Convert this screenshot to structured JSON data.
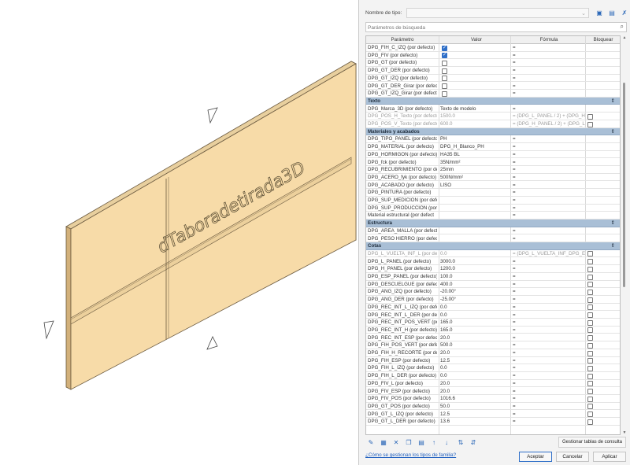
{
  "viewport": {
    "panel_text": "dTaboradetirada3D"
  },
  "dialog": {
    "type_name_label": "Nombre de tipo:",
    "type_name_value": "",
    "search_placeholder": "Parámetros de búsqueda",
    "columns": {
      "param": "Parámetro",
      "value": "Valor",
      "formula": "Fórmula",
      "lock": "Bloquear"
    },
    "rows": [
      {
        "kind": "param",
        "name": "DPG_FIH_C_IZQ (por defecto)",
        "check": true,
        "formula": "="
      },
      {
        "kind": "param",
        "name": "DPG_FIV (por defecto)",
        "check": true,
        "formula": "="
      },
      {
        "kind": "param",
        "name": "DPG_GT (por defecto)",
        "check": false,
        "formula": "="
      },
      {
        "kind": "param",
        "name": "DPG_GT_DER (por defecto)",
        "check": false,
        "formula": "="
      },
      {
        "kind": "param",
        "name": "DPG_GT_IZQ (por defecto)",
        "check": false,
        "formula": "="
      },
      {
        "kind": "param",
        "name": "DPG_GT_DER_Girar (por defect",
        "check": false,
        "formula": "="
      },
      {
        "kind": "param",
        "name": "DPG_GT_IZQ_Girar (por defect",
        "check": false,
        "formula": "="
      },
      {
        "kind": "group",
        "name": "Texto"
      },
      {
        "kind": "param",
        "name": "DPG_Marca_3D (por defecto)",
        "value": "Texto de modelo",
        "formula": "="
      },
      {
        "kind": "param",
        "muted": true,
        "name": "DPG_POS_H_Texto (por defecto",
        "value": "1500.0",
        "formula": "= (DPG_L_PANEL / 2) + (DPG_H_",
        "lock": false
      },
      {
        "kind": "param",
        "muted": true,
        "name": "DPG_POS_V_Texto (por defecto",
        "value": "600.0",
        "formula": "= (DPG_H_PANEL / 2) + (DPG_L_",
        "lock": false
      },
      {
        "kind": "group",
        "name": "Materiales y acabados"
      },
      {
        "kind": "param",
        "name": "DPG_TIPO_PANEL (por defecto)",
        "value": "PH",
        "formula": "="
      },
      {
        "kind": "param",
        "name": "DPG_MATERIAL (por defecto)",
        "value": "DPG_H_Blanco_PH",
        "formula": "="
      },
      {
        "kind": "param",
        "name": "DPG_HORMIGON (por defecto)",
        "value": "HA35 BL",
        "formula": "="
      },
      {
        "kind": "param",
        "name": "DPG_fck (por defecto)",
        "value": "35N/mm²",
        "formula": "="
      },
      {
        "kind": "param",
        "name": "DPG_RECUBRIMIENTO (por def",
        "value": "25mm",
        "formula": "="
      },
      {
        "kind": "param",
        "name": "DPG_ACERO_fyk (por defecto)",
        "value": "500N/mm²",
        "formula": "="
      },
      {
        "kind": "param",
        "name": "DPG_ACABADO (por defecto)",
        "value": "LISO",
        "formula": "="
      },
      {
        "kind": "param",
        "name": "DPG_PINTURA (por defecto)",
        "value": "",
        "formula": "="
      },
      {
        "kind": "param",
        "name": "DPG_SUP_MEDICION (por defe",
        "value": "",
        "formula": "="
      },
      {
        "kind": "param",
        "name": "DPG_SUP_PRODUCCION (por",
        "value": "",
        "formula": "="
      },
      {
        "kind": "param",
        "name": "Material estructural (por defect",
        "value": "",
        "formula": "="
      },
      {
        "kind": "group",
        "name": "Estructura"
      },
      {
        "kind": "param",
        "name": "DPG_AREA_MALLA (por defect",
        "value": "",
        "formula": "="
      },
      {
        "kind": "param",
        "name": "DPG_PESO HIERRO (por defect",
        "value": "",
        "formula": "="
      },
      {
        "kind": "group",
        "name": "Cotas"
      },
      {
        "kind": "param",
        "muted": true,
        "name": "DPG_L_VUELTA_INF_L (por defe",
        "value": "0.0",
        "formula": "= (DPG_L_VUELTA_INF_DPG_ES",
        "lock": false
      },
      {
        "kind": "param",
        "name": "DPG_L_PANEL (por defecto)",
        "value": "3000.0",
        "formula": "=",
        "lock": false
      },
      {
        "kind": "param",
        "name": "DPG_H_PANEL (por defecto)",
        "value": "1200.0",
        "formula": "=",
        "lock": false
      },
      {
        "kind": "param",
        "name": "DPG_ESP_PANEL (por defecto)",
        "value": "100.0",
        "formula": "=",
        "lock": false
      },
      {
        "kind": "param",
        "name": "DPG_DESCUELGUE (por defecto",
        "value": "400.0",
        "formula": "=",
        "lock": false
      },
      {
        "kind": "param",
        "name": "DPG_ANG_IZQ (por defecto)",
        "value": "-20.00°",
        "formula": "=",
        "lock": false
      },
      {
        "kind": "param",
        "name": "DPG_ANG_DER (por defecto)",
        "value": "-25.00°",
        "formula": "=",
        "lock": false
      },
      {
        "kind": "param",
        "name": "DPG_REC_INT_L_IZQ (por defec",
        "value": "0.0",
        "formula": "=",
        "lock": false
      },
      {
        "kind": "param",
        "name": "DPG_REC_INT_L_DER (por defe",
        "value": "0.0",
        "formula": "=",
        "lock": false
      },
      {
        "kind": "param",
        "name": "DPG_REC_INT_POS_VERT (por",
        "value": "165.0",
        "formula": "=",
        "lock": false
      },
      {
        "kind": "param",
        "name": "DPG_REC_INT_H (por defecto)",
        "value": "165.0",
        "formula": "=",
        "lock": false
      },
      {
        "kind": "param",
        "name": "DPG_REC_INT_ESP (por defecto",
        "value": "20.0",
        "formula": "=",
        "lock": false
      },
      {
        "kind": "param",
        "name": "DPG_FIH_POS_VERT (por defec",
        "value": "500.0",
        "formula": "=",
        "lock": false
      },
      {
        "kind": "param",
        "name": "DPG_FIH_H_RECORTE (por def",
        "value": "20.0",
        "formula": "=",
        "lock": false
      },
      {
        "kind": "param",
        "name": "DPG_FIH_ESP (por defecto)",
        "value": "12.5",
        "formula": "=",
        "lock": false
      },
      {
        "kind": "param",
        "name": "DPG_FIH_L_IZQ (por defecto)",
        "value": "0.0",
        "formula": "=",
        "lock": false
      },
      {
        "kind": "param",
        "name": "DPG_FIH_L_DER (por defecto)",
        "value": "0.0",
        "formula": "=",
        "lock": false
      },
      {
        "kind": "param",
        "name": "DPG_FIV_L (por defecto)",
        "value": "20.0",
        "formula": "=",
        "lock": false
      },
      {
        "kind": "param",
        "name": "DPG_FIV_ESP (por defecto)",
        "value": "20.0",
        "formula": "=",
        "lock": false
      },
      {
        "kind": "param",
        "name": "DPG_FIV_POS (por defecto)",
        "value": "1016.6",
        "formula": "=",
        "lock": false
      },
      {
        "kind": "param",
        "name": "DPG_GT_POS (por defecto)",
        "value": "50.0",
        "formula": "=",
        "lock": false
      },
      {
        "kind": "param",
        "name": "DPG_GT_L_IZQ (por defecto)",
        "value": "12.5",
        "formula": "=",
        "lock": false
      },
      {
        "kind": "param",
        "name": "DPG_GT_L_DER (por defecto)",
        "value": "13.6",
        "formula": "=",
        "lock": false
      }
    ],
    "manage_button": "Gestionar tablas de consulta",
    "help_link": "¿Cómo se gestionan los tipos de familia?",
    "ok": "Aceptar",
    "cancel": "Cancelar",
    "apply": "Aplicar"
  }
}
